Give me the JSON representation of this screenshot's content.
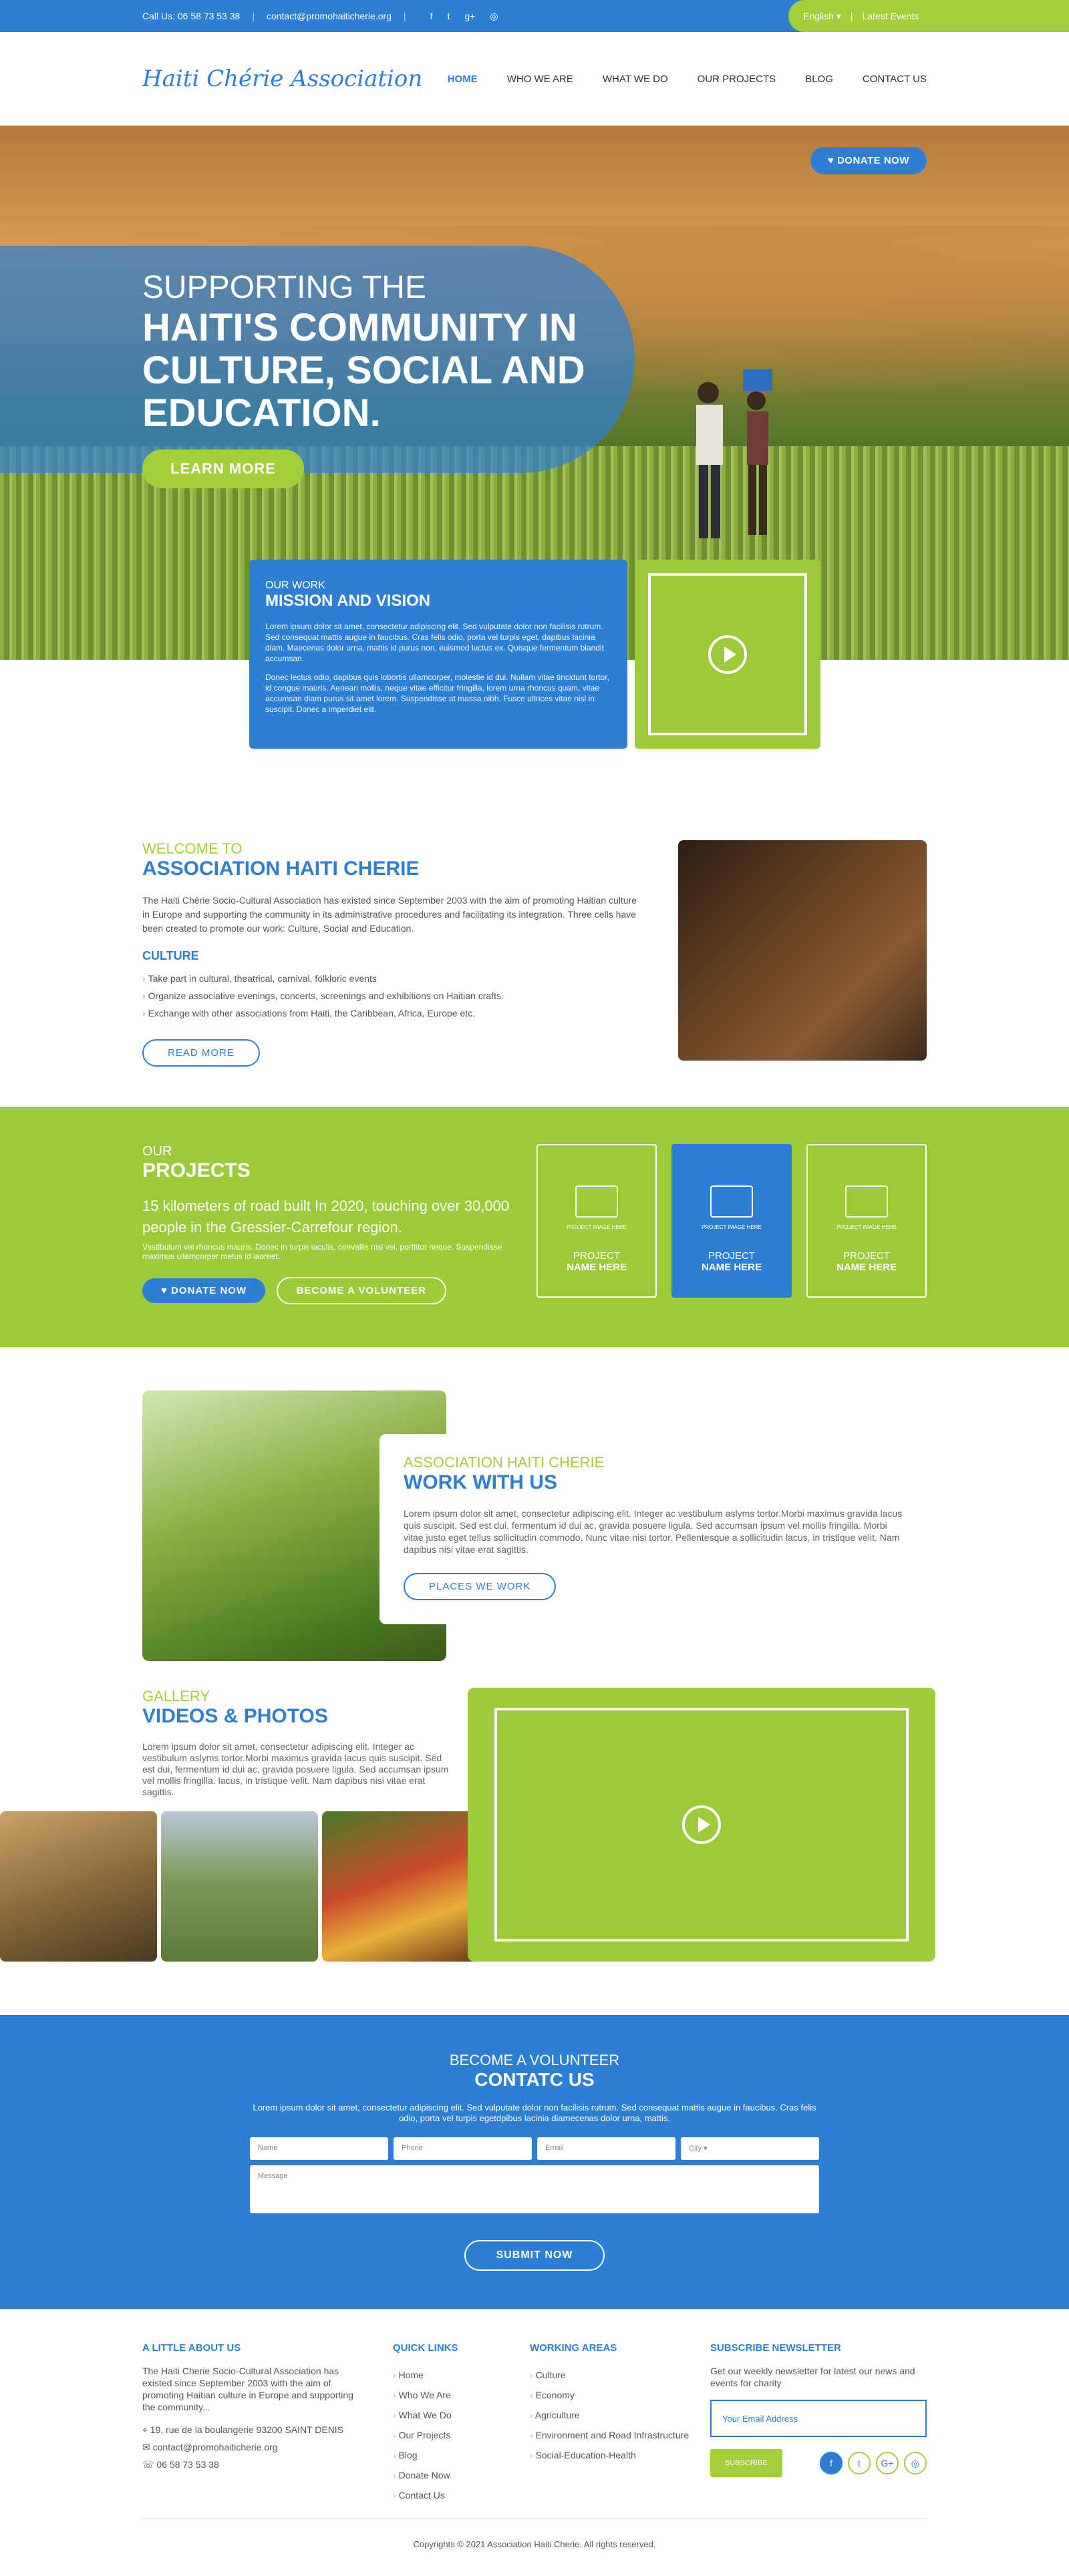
{
  "topbar": {
    "call": "Call Us: 06 58 73 53 38",
    "email": "contact@promohaiticherie.org",
    "lang": "English ▾",
    "events": "Latest Events"
  },
  "header": {
    "logo": "Haiti Chérie Association",
    "nav": [
      "HOME",
      "WHO WE ARE",
      "WHAT WE DO",
      "OUR PROJECTS",
      "BLOG",
      "CONTACT US"
    ],
    "donate": "♥ DONATE NOW"
  },
  "hero": {
    "line1": "SUPPORTING THE",
    "line2": "HAITI'S COMMUNITY IN CULTURE, SOCIAL AND EDUCATION.",
    "button": "LEARN MORE"
  },
  "work": {
    "small": "OUR WORK",
    "title": "MISSION AND VISION",
    "p1": "Lorem ipsum dolor sit amet, consectetur adipiscing elit. Sed vulputate dolor non facilisis rutrum. Sed consequat mattis augue in faucibus. Cras felis odio, porta vel turpis eget, dapibus lacinia diam. Maecenas dolor urna, mattis id purus non, euismod luctus ex. Quisque fermentum blandit accumsan.",
    "p2": "Donec lectus odio, dapibus quis lobortis ullamcorper, molestie id dui. Nullam vitae tincidunt tortor, id congue mauris. Aenean mollis, neque vitae efficitur fringilla, lorem urna rhoncus quam, vitae accumsan diam purus sit amet lorem. Suspendisse at massa nibh. Fusce ultrices vitae nisl in suscipit. Donec a imperdiet elit."
  },
  "welcome": {
    "small": "WELCOME TO",
    "title": "ASSOCIATION HAITI CHERIE",
    "text": "The Haiti Chérie Socio-Cultural Association has existed since September 2003 with the aim of promoting Haitian culture in Europe and supporting the community in its administrative procedures and facilitating its integration. Three cells have been created to promote our work: Culture, Social and Education.",
    "sub": "CULTURE",
    "items": [
      "Take part in cultural, theatrical, carnival, folkloric events",
      "Organize associative evenings, concerts, screenings and exhibitions on Haitian crafts.",
      "Exchange with other associations from Haiti, the Caribbean, Africa, Europe etc."
    ],
    "button": "READ MORE"
  },
  "projects": {
    "small": "OUR",
    "title": "PROJECTS",
    "headline": "15 kilometers of road built In 2020, touching over 30,000 people in the Gressier-Carrefour region.",
    "desc": "Vestibulum vel rhoncus mauris. Donec in turpis iaculis, convallis nisl vel, porttitor neque. Suspendisse maximus ullamcorper metus id laoreet.",
    "donate": "♥ DONATE NOW",
    "volunteer": "BECOME A VOLUNTEER",
    "cards": [
      {
        "tiny": "PROJECT IMAGE HERE",
        "p": "PROJECT",
        "n": "NAME HERE"
      },
      {
        "tiny": "PROJECT IMAGE HERE",
        "p": "PROJECT",
        "n": "NAME HERE"
      },
      {
        "tiny": "PROJECT IMAGE HERE",
        "p": "PROJECT",
        "n": "NAME HERE"
      }
    ]
  },
  "wwu": {
    "small": "ASSOCIATION HAITI CHERIE",
    "title": "WORK WITH US",
    "text": "Lorem ipsum dolor sit amet, consectetur adipiscing elit. Integer ac vestibulum aslyms tortor.Morbi maximus gravida lacus quis suscipit. Sed est dui, fermentum id dui ac, gravida posuere ligula. Sed accumsan ipsum vel mollis fringilla. Morbi vitae justo eget tellus sollicitudin commodo. Nunc vitae nisi tortor. Pellentesque a sollicitudin lacus, in tristique velit. Nam dapibus nisi vitae erat sagittis.",
    "button": "PLACES WE WORK"
  },
  "gallery": {
    "small": "GALLERY",
    "title": "VIDEOS & PHOTOS",
    "text": "Lorem ipsum dolor sit amet, consectetur adipiscing elit. Integer ac vestibulum aslyms tortor.Morbi maximus gravida lacus quis suscipit. Sed est dui, fermentum id dui ac, gravida posuere ligula. Sed accumsan ipsum vel mollis fringilla. lacus, in tristique velit. Nam dapibus nisi vitae erat sagittis."
  },
  "contact": {
    "small": "BECOME A VOLUNTEER",
    "title": "CONTATC US",
    "text": "Lorem ipsum dolor sit amet, consectetur adipiscing elit. Sed vulputate dolor non facilisis rutrum. Sed consequat mattis augue in faucibus. Cras felis odio, porta vel turpis egetdpibus lacinia diamecenas dolor urna, mattis.",
    "name": "Name",
    "phone": "Phone",
    "email": "Email",
    "city": "City ▾",
    "message": "Message",
    "submit": "SUBMIT NOW"
  },
  "footer": {
    "about_h": "A LITTLE ABOUT US",
    "about": "The Haiti Cherie Socio-Cultural Association has existed since September 2003 with the aim of promoting Haitian culture in Europe and supporting the community...",
    "addr": "19, rue de la boulangerie 93200 SAINT DENIS",
    "mail": "contact@promohaiticherie.org",
    "phone": "06 58 73 53 38",
    "ql_h": "QUICK LINKS",
    "ql": [
      "Home",
      "Who We Are",
      "What We Do",
      "Our Projects",
      "Blog",
      "Donate Now",
      "Contact Us"
    ],
    "wa_h": "WORKING AREAS",
    "wa": [
      "Culture",
      "Economy",
      "Agriculture",
      "Environment and Road Infrastructure",
      "Social-Education-Health"
    ],
    "nl_h": "SUBSCRIBE NEWSLETTER",
    "nl": "Get our weekly newsletter for latest our news and events for charity",
    "nl_ph": "Your Email Address",
    "nl_btn": "SUBSCRIBE",
    "copy": "Copyrights © 2021 Association Haiti Cherie. All rights reserved."
  }
}
